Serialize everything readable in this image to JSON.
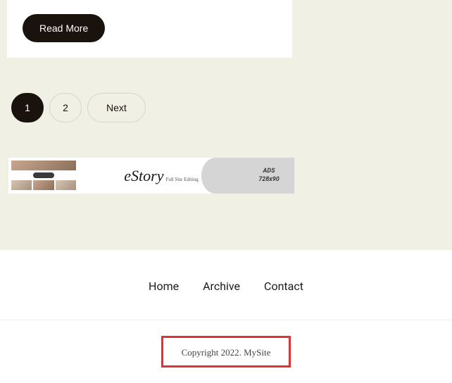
{
  "article": {
    "read_more_label": "Read More"
  },
  "pagination": {
    "page1": "1",
    "page2": "2",
    "next": "Next"
  },
  "ad": {
    "brand": "eStory",
    "tagline": "Full Site Editing",
    "label_line1": "ADS",
    "label_line2": "728x90"
  },
  "footer": {
    "nav": {
      "home": "Home",
      "archive": "Archive",
      "contact": "Contact"
    },
    "copyright": "Copyright 2022. MySite"
  }
}
